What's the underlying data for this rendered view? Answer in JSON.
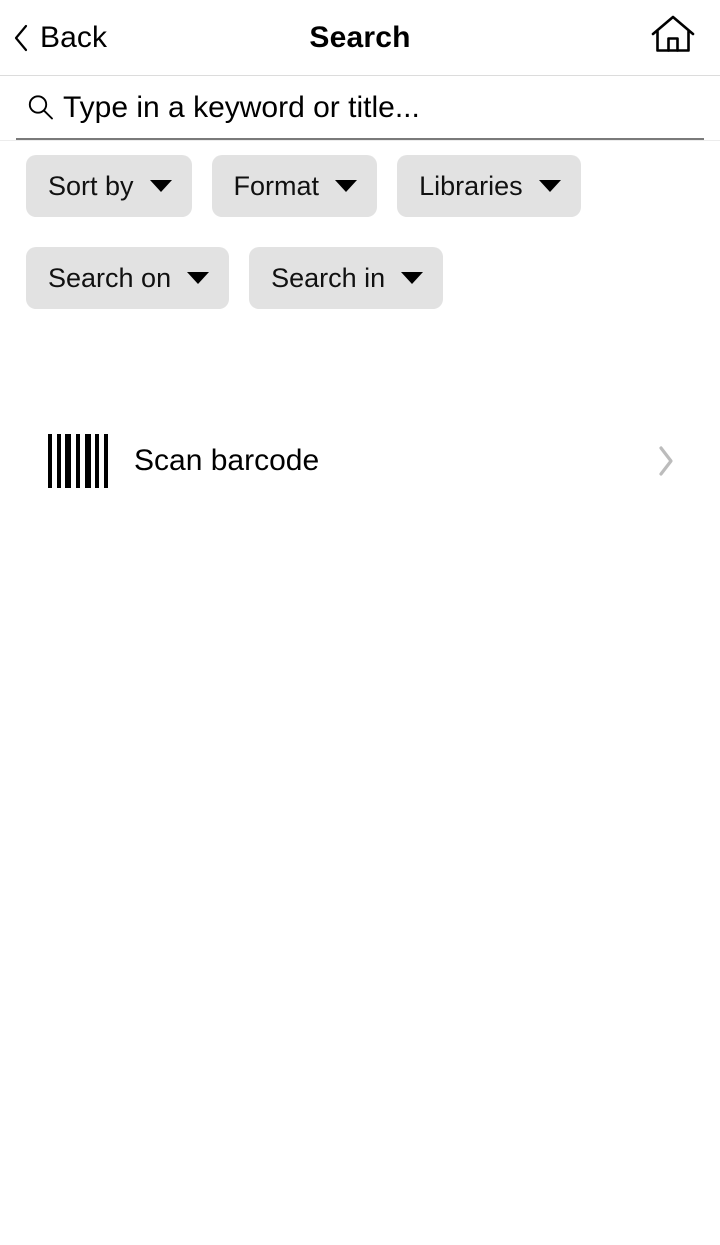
{
  "header": {
    "back_label": "Back",
    "back_icon": "chevron-left-icon",
    "title": "Search",
    "home_icon": "home-icon"
  },
  "search": {
    "icon": "search-icon",
    "value": "",
    "placeholder": "Type in a keyword or title..."
  },
  "filters": {
    "rows": [
      [
        {
          "label": "Sort by",
          "icon": "chevron-down-icon"
        },
        {
          "label": "Format",
          "icon": "chevron-down-icon"
        },
        {
          "label": "Libraries",
          "icon": "chevron-down-icon"
        }
      ],
      [
        {
          "label": "Search on",
          "icon": "chevron-down-icon"
        },
        {
          "label": "Search in",
          "icon": "chevron-down-icon"
        }
      ]
    ]
  },
  "actions": {
    "scan_barcode": {
      "label": "Scan barcode",
      "leading_icon": "barcode-icon",
      "trailing_icon": "chevron-right-icon"
    }
  },
  "colors": {
    "background": "#ffffff",
    "text": "#000000",
    "chip_background": "#e2e2e2",
    "divider": "#dcdcdc",
    "search_underline": "#7a7a7a",
    "chevron_gray": "#bcbcbc"
  }
}
